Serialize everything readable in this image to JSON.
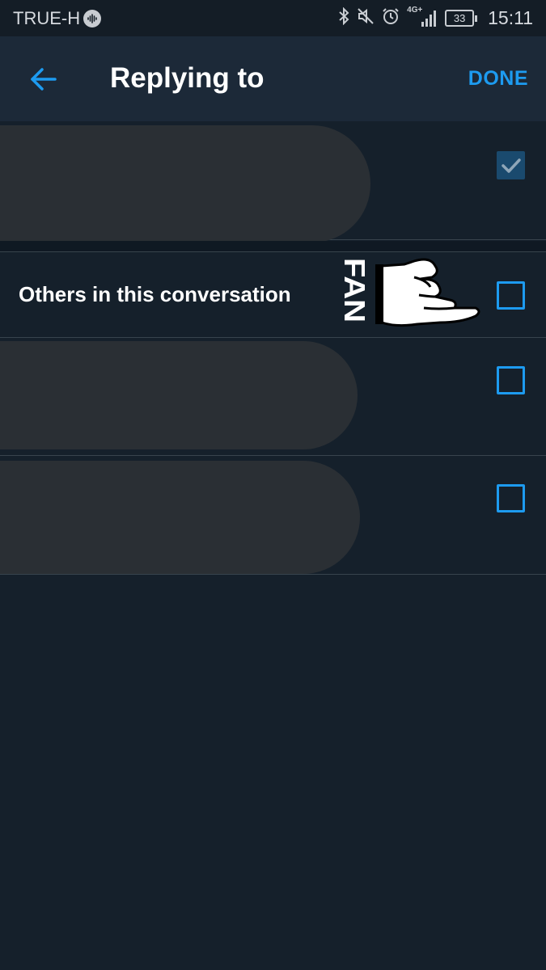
{
  "status_bar": {
    "carrier": "TRUE-H",
    "network": "4G+",
    "battery": "33",
    "time": "15:11",
    "icons": [
      "podcast-icon",
      "bluetooth-icon",
      "mute-icon",
      "alarm-icon",
      "signal-icon",
      "battery-icon"
    ]
  },
  "header": {
    "title": "Replying to",
    "done_label": "DONE",
    "back_icon": "arrow-left-icon"
  },
  "rows": [
    {
      "redacted": true,
      "checked": true
    },
    {
      "label": "Others in this conversation",
      "checked": false,
      "sticker_text": "FAN"
    },
    {
      "redacted": true,
      "checked": false
    },
    {
      "redacted": true,
      "checked": false
    }
  ],
  "colors": {
    "background": "#15202b",
    "header": "#1c2938",
    "accent": "#1d9bf0",
    "checked_fill": "#1a4a6e",
    "divider": "#38444d"
  }
}
